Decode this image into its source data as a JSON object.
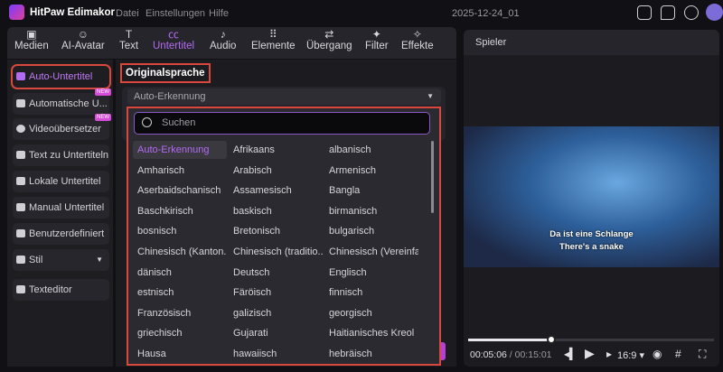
{
  "app": {
    "name": "HitPaw Edimakor",
    "menu": [
      "Datei",
      "Einstellungen",
      "Hilfe"
    ],
    "project": "2025-12-24_01"
  },
  "titlebar_icons": [
    "layout-icon",
    "feedback-icon",
    "download-icon",
    "avatar"
  ],
  "toolbar": [
    {
      "label": "Medien",
      "icon": "media-icon"
    },
    {
      "label": "AI-Avatar",
      "icon": "ai-avatar-icon"
    },
    {
      "label": "Text",
      "icon": "text-icon"
    },
    {
      "label": "Untertitel",
      "icon": "subtitle-icon",
      "active": true
    },
    {
      "label": "Audio",
      "icon": "audio-icon"
    },
    {
      "label": "Elemente",
      "icon": "elements-icon"
    },
    {
      "label": "Übergang",
      "icon": "transition-icon"
    },
    {
      "label": "Filter",
      "icon": "filter-icon"
    },
    {
      "label": "Effekte",
      "icon": "effects-icon"
    }
  ],
  "sidebar": {
    "items": [
      {
        "label": "Auto-Untertitel",
        "active": true
      },
      {
        "label": "Automatische U...",
        "badge": "NEW"
      },
      {
        "label": "Videoübersetzer",
        "badge": "NEW"
      },
      {
        "label": "Text zu Untertiteln"
      },
      {
        "label": "Lokale Untertitel"
      },
      {
        "label": "Manual Untertitel"
      },
      {
        "label": "Benutzerdefiniert"
      },
      {
        "label": "Stil"
      },
      {
        "label": "Texteditor"
      }
    ]
  },
  "main": {
    "section_title": "Originalsprache",
    "language_select": "Auto-Erkennung",
    "search_placeholder": "Suchen",
    "languages": [
      "Auto-Erkennung",
      "Afrikaans",
      "albanisch",
      "Amharisch",
      "Arabisch",
      "Armenisch",
      "Aserbaidschanisch",
      "Assamesisch",
      "Bangla",
      "Baschkirisch",
      "baskisch",
      "birmanisch",
      "bosnisch",
      "Bretonisch",
      "bulgarisch",
      "Chinesisch (Kanton...",
      "Chinesisch (traditio...",
      "Chinesisch (Vereinfa...",
      "dänisch",
      "Deutsch",
      "Englisch",
      "estnisch",
      "Färöisch",
      "finnisch",
      "Französisch",
      "galizisch",
      "georgisch",
      "griechisch",
      "Gujarati",
      "Haitianisches Kreol",
      "Hausa",
      "hawaiisch",
      "hebräisch"
    ],
    "selected_language": "Auto-Erkennung"
  },
  "player": {
    "title": "Spieler",
    "subtitle_line1": "Da ist eine Schlange",
    "subtitle_line2": "There's a snake",
    "current_time": "00:05:06",
    "total_time": "/ 00:15:01",
    "progress": 0.34,
    "aspect": "16:9"
  },
  "colors": {
    "accent": "#b36bf2",
    "highlight": "#d9473d",
    "badge": "#d74bd9"
  }
}
